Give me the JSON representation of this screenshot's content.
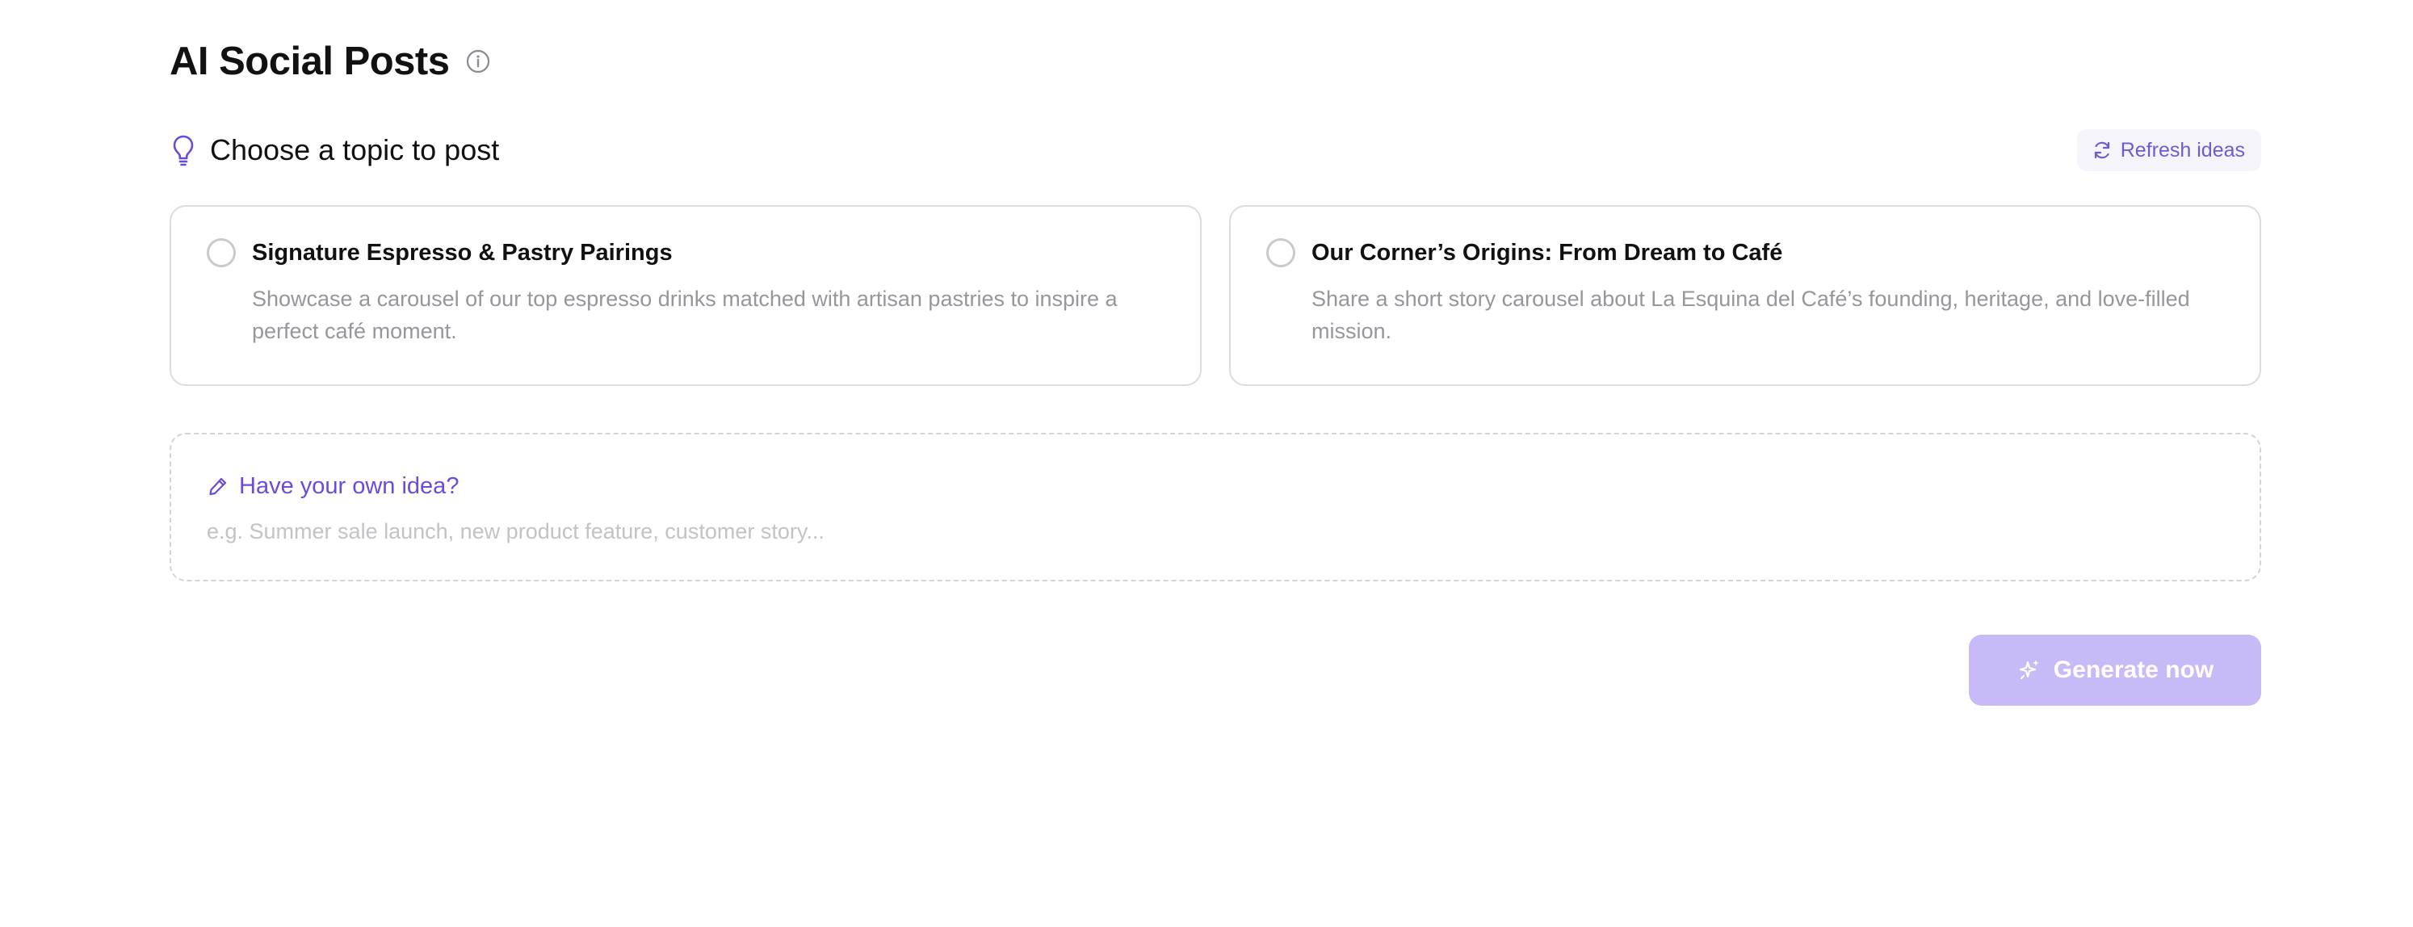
{
  "header": {
    "title": "AI Social Posts",
    "info_icon": "info-icon"
  },
  "topics": {
    "heading": "Choose a topic to post",
    "heading_icon": "lightbulb-icon",
    "refresh_label": "Refresh ideas",
    "refresh_icon": "refresh-icon",
    "items": [
      {
        "title": "Signature Espresso & Pastry Pairings",
        "description": "Showcase a carousel of our top espresso drinks matched with artisan pastries to inspire a perfect café moment.",
        "selected": false
      },
      {
        "title": "Our Corner’s Origins: From Dream to Café",
        "description": "Share a short story carousel about La Esquina del Café’s founding, heritage, and love-filled mission.",
        "selected": false
      }
    ]
  },
  "own_idea": {
    "label": "Have your own idea?",
    "icon": "pencil-icon",
    "placeholder": "e.g. Summer sale launch, new product feature, customer story...",
    "value": ""
  },
  "actions": {
    "generate_label": "Generate now",
    "generate_icon": "sparkles-icon",
    "generate_enabled": false
  },
  "colors": {
    "accent": "#6b4ae0",
    "accent_soft": "#c8baf6",
    "refresh_text": "#6d5bd0",
    "muted_text": "#96969c",
    "border": "#dcdcdf"
  }
}
